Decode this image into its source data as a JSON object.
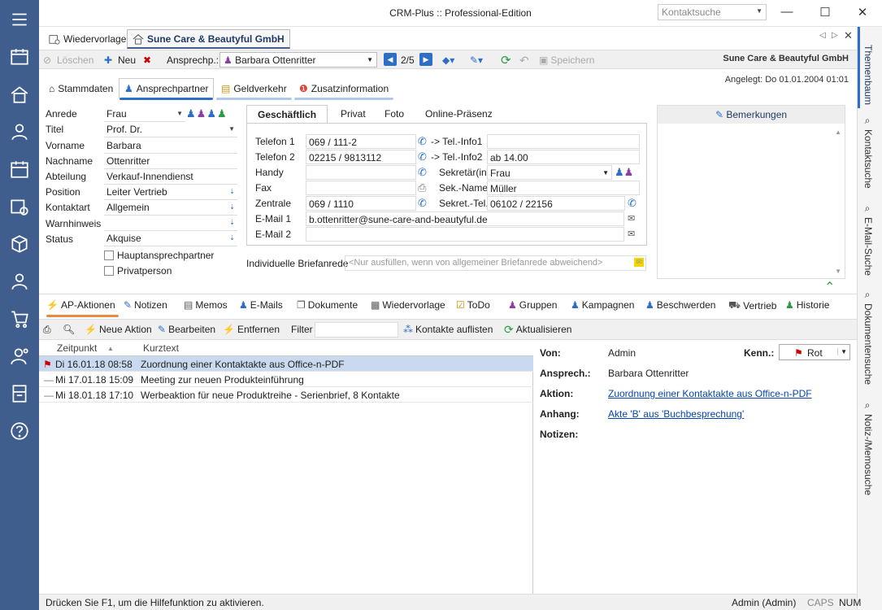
{
  "window": {
    "title": "CRM-Plus :: Professional-Edition",
    "search_placeholder": "Kontaktsuche"
  },
  "doc_tabs": [
    {
      "label": "Wiedervorlage"
    },
    {
      "label": "Sune Care & Beautyful GmbH"
    }
  ],
  "toolbar": {
    "delete": "Löschen",
    "new": "Neu",
    "contact_label": "Ansprechp.:",
    "contact_value": "Barbara Ottenritter",
    "pager": "2/5",
    "save": "Speichern",
    "company": "Sune Care & Beautyful GmbH"
  },
  "subtabs": [
    "Stammdaten",
    "Ansprechpartner",
    "Geldverkehr",
    "Zusatzinformation"
  ],
  "created": "Angelegt:  Do 01.01.2004 01:01",
  "form": {
    "fields": [
      {
        "label": "Anrede",
        "value": "Frau"
      },
      {
        "label": "Titel",
        "value": "Prof. Dr."
      },
      {
        "label": "Vorname",
        "value": "Barbara"
      },
      {
        "label": "Nachname",
        "value": "Ottenritter"
      },
      {
        "label": "Abteilung",
        "value": "Verkauf-Innendienst"
      },
      {
        "label": "Position",
        "value": "Leiter Vertrieb"
      },
      {
        "label": "Kontaktart",
        "value": "Allgemein"
      },
      {
        "label": "Warnhinweis",
        "value": ""
      },
      {
        "label": "Status",
        "value": "Akquise"
      }
    ],
    "check_main": "Hauptansprechpartner",
    "check_private": "Privatperson"
  },
  "detail_tabs": [
    "Geschäftlich",
    "Privat",
    "Foto",
    "Online-Präsenz"
  ],
  "detail_left": [
    {
      "label": "Telefon 1",
      "value": "069 / 111-2"
    },
    {
      "label": "Telefon 2",
      "value": "02215 / 9813112"
    },
    {
      "label": "Handy",
      "value": ""
    },
    {
      "label": "Fax",
      "value": ""
    },
    {
      "label": "Zentrale",
      "value": "069 / 1110"
    }
  ],
  "detail_right": [
    {
      "label": "-> Tel.-Info1",
      "value": ""
    },
    {
      "label": "-> Tel.-Info2",
      "value": "ab 14.00"
    },
    {
      "label": "Sekretär(in)",
      "value": "Frau"
    },
    {
      "label": "Sek.-Name",
      "value": "Müller"
    },
    {
      "label": "Sekret.-Tel.",
      "value": "06102 / 22156"
    }
  ],
  "emails": [
    {
      "label": "E-Mail 1",
      "value": "b.ottenritter@sune-care-and-beautyful.de"
    },
    {
      "label": "E-Mail 2",
      "value": ""
    }
  ],
  "remarks": "Bemerkungen",
  "brief": {
    "label": "Individuelle Briefanrede",
    "placeholder": "<Nur ausfüllen, wenn von allgemeiner Briefanrede abweichend>"
  },
  "bottom_tabs": [
    "AP-Aktionen",
    "Notizen",
    "Memos",
    "E-Mails",
    "Dokumente",
    "Wiedervorlage",
    "ToDo",
    "Gruppen",
    "Kampagnen",
    "Beschwerden",
    "Vertrieb",
    "Historie"
  ],
  "btoolbar": {
    "new": "Neue Aktion",
    "edit": "Bearbeiten",
    "remove": "Entfernen",
    "filter": "Filter",
    "list": "Kontakte auflisten",
    "refresh": "Aktualisieren"
  },
  "list": {
    "headers": [
      "Zeitpunkt",
      "Kurztext"
    ],
    "rows": [
      {
        "time": "Di 16.01.18 08:58",
        "text": "Zuordnung einer Kontaktakte aus Office-n-PDF"
      },
      {
        "time": "Mi 17.01.18 15:09",
        "text": "Meeting zur neuen Produkteinführung"
      },
      {
        "time": "Mi 18.01.18 17:10",
        "text": "Werbeaktion für neue Produktreihe - Serienbrief, 8 Kontakte"
      }
    ]
  },
  "action_detail": {
    "von_label": "Von:",
    "von": "Admin",
    "kenn_label": "Kenn.:",
    "kenn": "Rot",
    "ansp_label": "Ansprech.:",
    "ansp": "Barbara Ottenritter",
    "aktion_label": "Aktion:",
    "aktion": "Zuordnung einer Kontaktakte aus Office-n-PDF",
    "anhang_label": "Anhang:",
    "anhang": "Akte 'B' aus 'Buchbesprechung'",
    "notizen_label": "Notizen:"
  },
  "right_tabs": [
    "Themenbaum",
    "Kontaktsuche",
    "E-Mail-Suche",
    "Dokumentensuche",
    "Notiz-/Memosuche"
  ],
  "status": {
    "help": "Drücken Sie F1, um die Hilfefunktion zu aktivieren.",
    "user": "Admin (Admin)",
    "caps": "CAPS",
    "num": "NUM"
  }
}
